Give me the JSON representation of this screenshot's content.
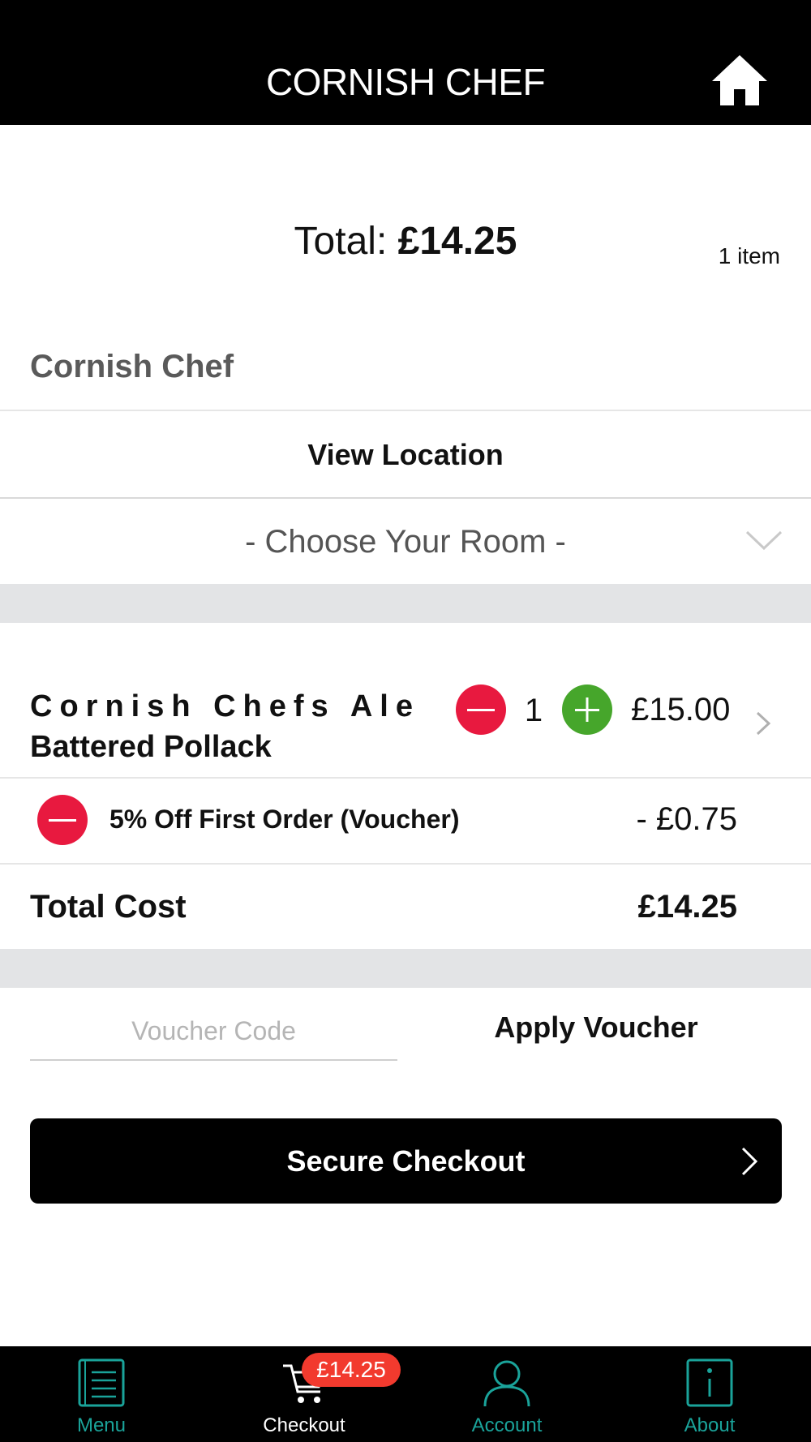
{
  "header": {
    "title": "CORNISH CHEF"
  },
  "summary": {
    "total_label": "Total:",
    "total_value": "£14.25",
    "item_count": "1 item"
  },
  "venue": {
    "name": "Cornish Chef",
    "view_location_label": "View Location",
    "room_placeholder": "- Choose Your Room -"
  },
  "basket": {
    "items": [
      {
        "name_line1": "Cornish Chefs Ale",
        "name_line2": "Battered Pollack",
        "quantity": "1",
        "price": "£15.00"
      }
    ],
    "voucher": {
      "label": "5% Off First Order (Voucher)",
      "amount": "- £0.75"
    },
    "total_cost_label": "Total Cost",
    "total_cost_value": "£14.25"
  },
  "voucher_entry": {
    "placeholder": "Voucher Code",
    "value": "",
    "apply_label": "Apply Voucher"
  },
  "checkout": {
    "label": "Secure Checkout"
  },
  "tabs": [
    {
      "label": "Menu",
      "icon": "menu-book-icon"
    },
    {
      "label": "Checkout",
      "icon": "cart-icon",
      "badge": "£14.25",
      "active": true
    },
    {
      "label": "Account",
      "icon": "user-icon"
    },
    {
      "label": "About",
      "icon": "info-icon"
    }
  ],
  "colors": {
    "accent": "#1aa39a",
    "minus": "#e8193f",
    "plus": "#46a62b",
    "badge": "#f23a2e"
  }
}
